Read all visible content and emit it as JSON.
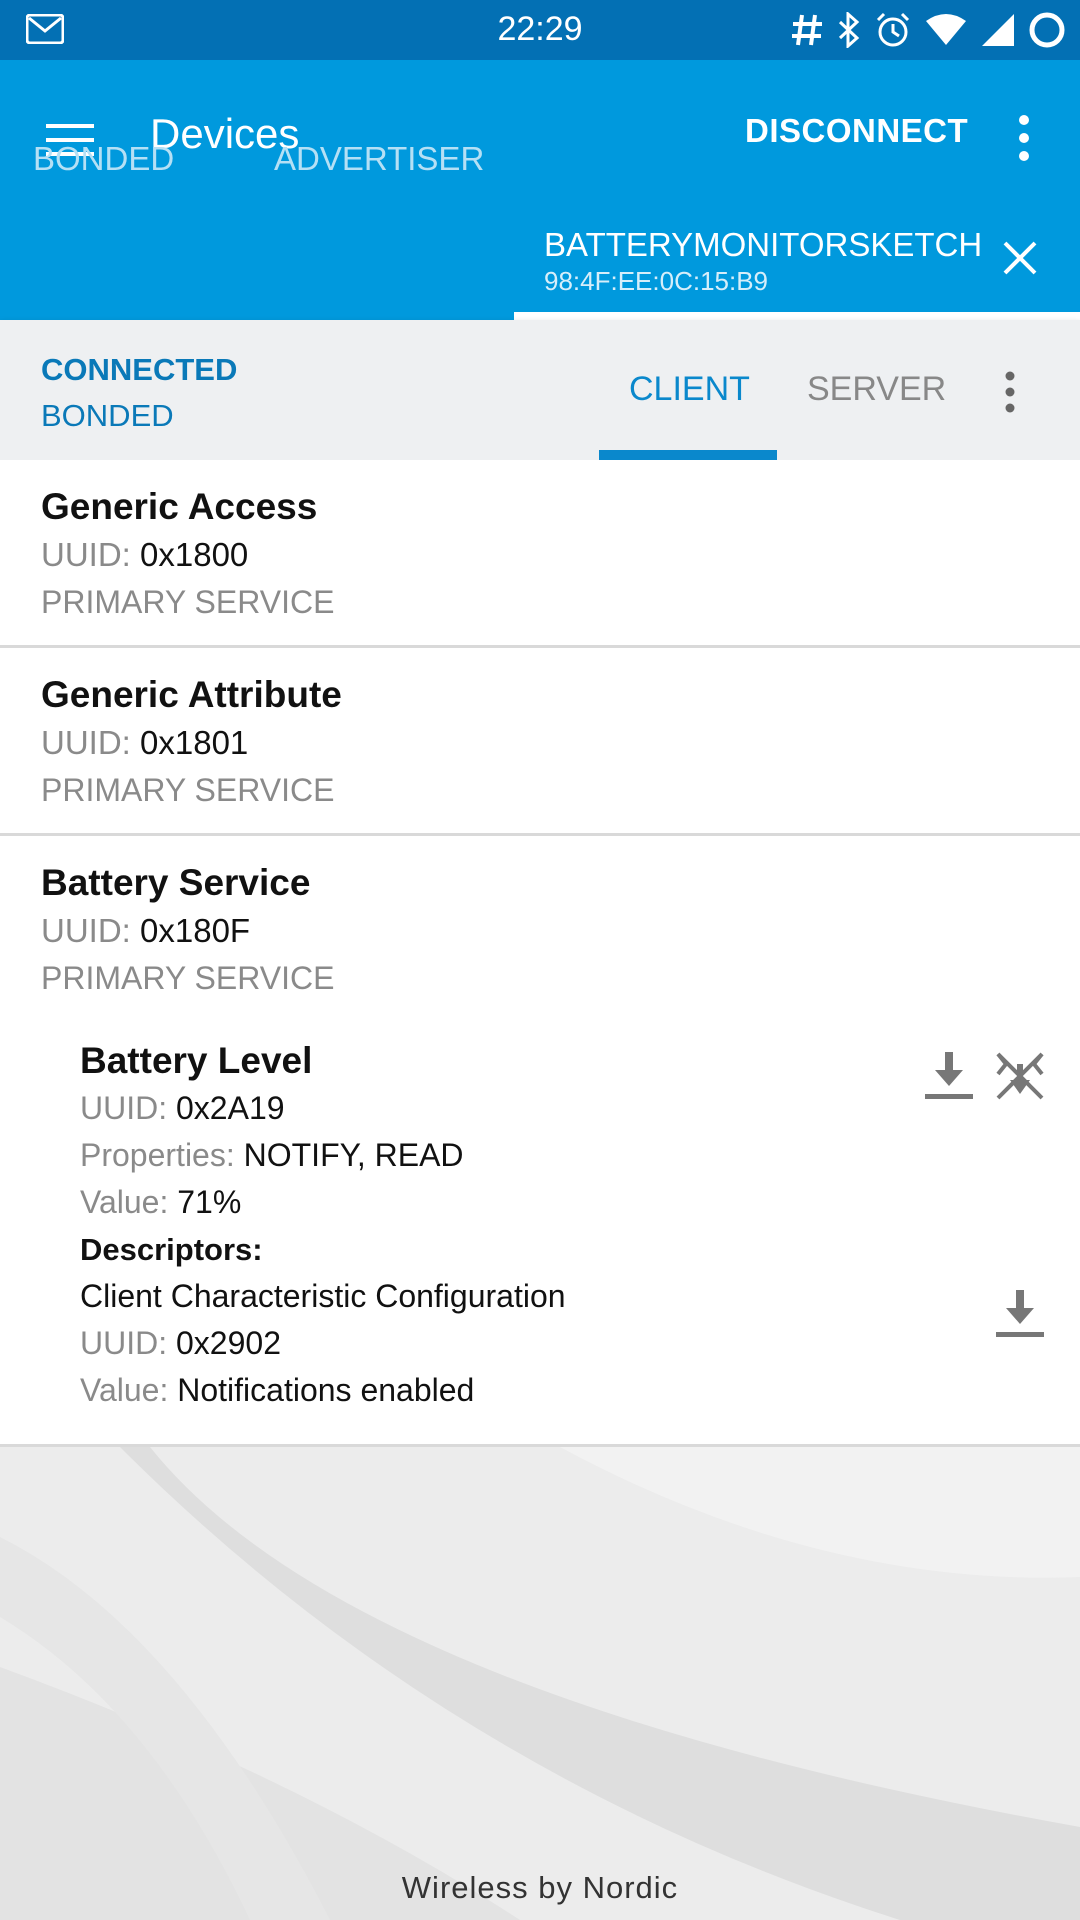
{
  "status_bar": {
    "time": "22:29",
    "left_icon": "gmail-icon",
    "right_icons": [
      "hash-icon",
      "bluetooth-icon",
      "alarm-icon",
      "wifi-icon",
      "signal-icon",
      "sync-icon"
    ]
  },
  "app_bar": {
    "title": "Devices",
    "disconnect_label": "DISCONNECT",
    "tabs": [
      {
        "label": "BONDED"
      },
      {
        "label": "ADVERTISER"
      },
      {
        "label": "BATTERYMONITORSKETCH",
        "sub": "98:4F:EE:0C:15:B9"
      }
    ]
  },
  "connection": {
    "state": "CONNECTED",
    "bond": "BONDED",
    "tabs": [
      {
        "label": "CLIENT"
      },
      {
        "label": "SERVER"
      }
    ]
  },
  "services": [
    {
      "name": "Generic Access",
      "uuid_label": "UUID:",
      "uuid": "0x1800",
      "type": "PRIMARY SERVICE"
    },
    {
      "name": "Generic Attribute",
      "uuid_label": "UUID:",
      "uuid": "0x1801",
      "type": "PRIMARY SERVICE"
    },
    {
      "name": "Battery Service",
      "uuid_label": "UUID:",
      "uuid": "0x180F",
      "type": "PRIMARY SERVICE",
      "characteristic": {
        "name": "Battery Level",
        "uuid_label": "UUID:",
        "uuid": "0x2A19",
        "properties_label": "Properties:",
        "properties": "NOTIFY, READ",
        "value_label": "Value:",
        "value": "71%",
        "descriptors_label": "Descriptors:",
        "descriptor": {
          "name": "Client Characteristic Configuration",
          "uuid_label": "UUID:",
          "uuid": "0x2902",
          "value_label": "Value:",
          "value": "Notifications enabled"
        }
      }
    }
  ],
  "footer": {
    "text": "Wireless by Nordic"
  },
  "colors": {
    "status_bar": "#0370b4",
    "app_bar": "#0099dd",
    "accent": "#0a88cc"
  }
}
